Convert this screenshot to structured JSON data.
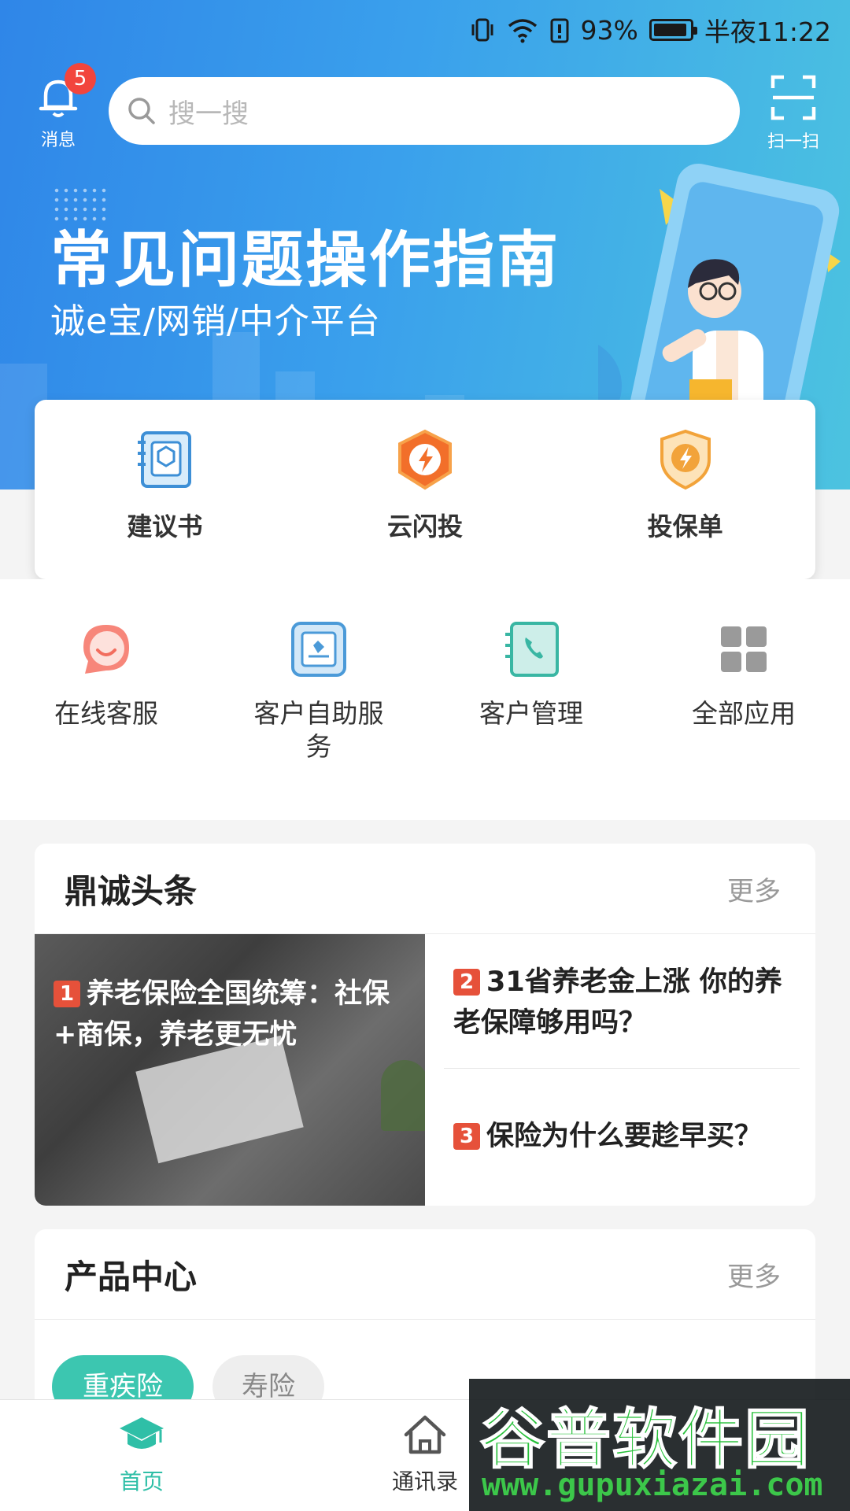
{
  "status_bar": {
    "battery": "93%",
    "time": "半夜11:22",
    "battery_level": 0.93
  },
  "header": {
    "bell_label": "消息",
    "badge_count": "5",
    "search_placeholder": "搜一搜",
    "scan_label": "扫一扫"
  },
  "banner": {
    "title": "常见问题操作指南",
    "subtitle": "诚e宝/网销/中介平台"
  },
  "top_actions": [
    {
      "label": "建议书",
      "icon": "proposal-book-icon"
    },
    {
      "label": "云闪投",
      "icon": "flash-shield-icon"
    },
    {
      "label": "投保单",
      "icon": "policy-shield-icon"
    }
  ],
  "grid_actions": [
    {
      "label": "在线客服",
      "icon": "chat-bubble-icon"
    },
    {
      "label": "客户自助服务",
      "icon": "self-service-icon"
    },
    {
      "label": "客户管理",
      "icon": "phone-book-icon"
    },
    {
      "label": "全部应用",
      "icon": "apps-grid-icon"
    }
  ],
  "news": {
    "title": "鼎诚头条",
    "more": "更多",
    "items": [
      {
        "num": "1",
        "text": "养老保险全国统筹：社保+商保，养老更无忧"
      },
      {
        "num": "2",
        "text": "31省养老金上涨 你的养老保障够用吗？"
      },
      {
        "num": "3",
        "text": "保险为什么要趁早买？"
      }
    ]
  },
  "products": {
    "title": "产品中心",
    "more": "更多",
    "chips": [
      "重疾险",
      "寿险"
    ]
  },
  "bottom_nav": [
    {
      "label": "首页",
      "icon": "graduation-cap-icon"
    },
    {
      "label": "通讯录",
      "icon": "home-icon"
    }
  ],
  "watermark": {
    "brand": "谷普软件园",
    "url": "www.gupuxiazai.com"
  },
  "colors": {
    "accent_green": "#3cc6b0",
    "badge_red": "#f2453d",
    "hero_blue": "#2f86e8"
  }
}
